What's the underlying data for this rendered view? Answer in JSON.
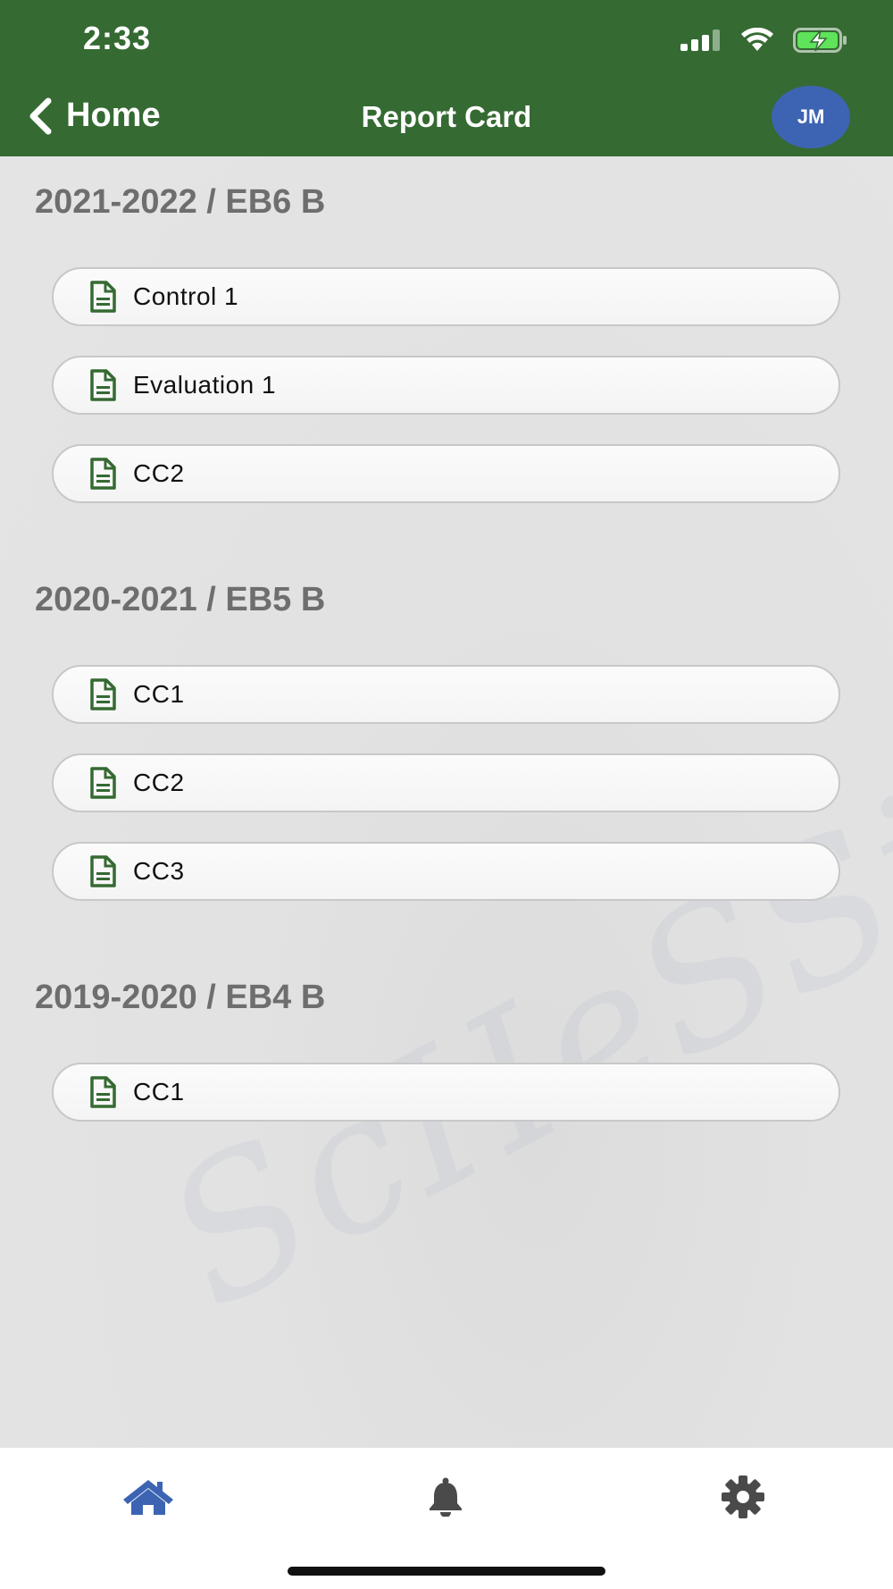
{
  "status_bar": {
    "time": "2:33"
  },
  "nav": {
    "back_label": "Home",
    "title": "Report Card",
    "avatar_initials": "JM"
  },
  "sections": [
    {
      "title": "2021-2022 / EB6 B",
      "items": [
        "Control 1",
        "Evaluation 1",
        "CC2"
      ]
    },
    {
      "title": "2020-2021 / EB5 B",
      "items": [
        "CC1",
        "CC2",
        "CC3"
      ]
    },
    {
      "title": "2019-2020 / EB4 B",
      "items": [
        "CC1"
      ]
    }
  ],
  "tabbar": {
    "icons": [
      "home-icon",
      "bell-icon",
      "gear-icon"
    ]
  },
  "colors": {
    "header_bg": "#356a32",
    "avatar_bg": "#3d64b3",
    "doc_icon": "#356a32",
    "home_tab_active": "#3d64b3",
    "tab_inactive": "#4a4a4a"
  }
}
